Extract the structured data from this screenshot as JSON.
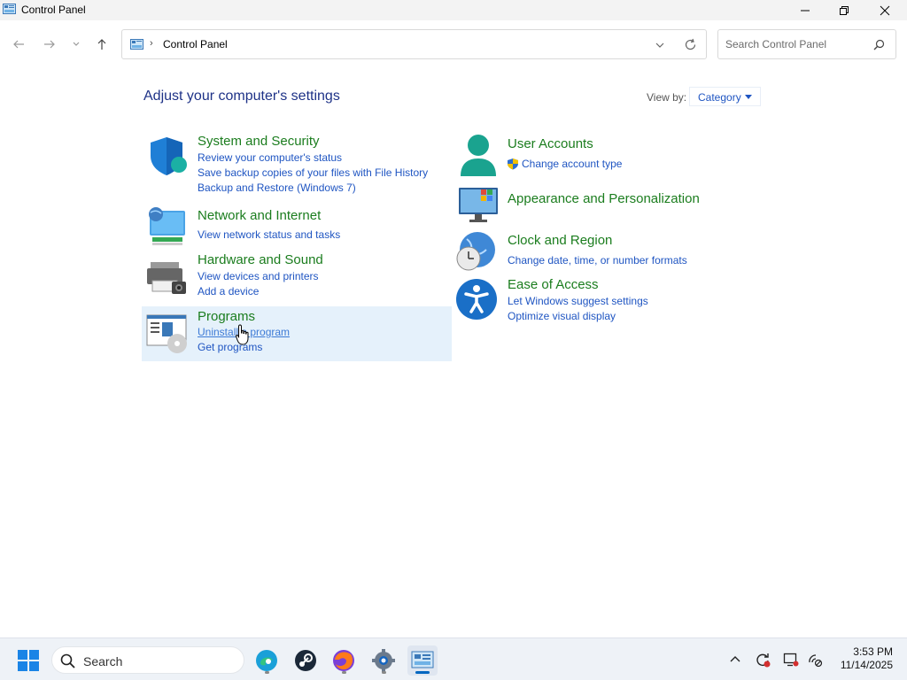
{
  "window": {
    "title": "Control Panel"
  },
  "address": {
    "crumb": "Control Panel",
    "search_placeholder": "Search Control Panel"
  },
  "content": {
    "heading": "Adjust your computer's settings",
    "view_by_label": "View by:",
    "view_by_value": "Category"
  },
  "categories": [
    {
      "title": "System and Security",
      "icon": "shield-icon",
      "links": [
        "Review your computer's status",
        "Save backup copies of your files with File History",
        "Backup and Restore (Windows 7)"
      ]
    },
    {
      "title": "Network and Internet",
      "icon": "network-icon",
      "links": [
        "View network status and tasks"
      ]
    },
    {
      "title": "Hardware and Sound",
      "icon": "printer-icon",
      "links": [
        "View devices and printers",
        "Add a device"
      ]
    },
    {
      "title": "Programs",
      "icon": "programs-icon",
      "links": [
        "Uninstall a program",
        "Get programs"
      ]
    },
    {
      "title": "User Accounts",
      "icon": "user-icon",
      "links": [
        "Change account type"
      ]
    },
    {
      "title": "Appearance and Personalization",
      "icon": "monitor-icon",
      "links": []
    },
    {
      "title": "Clock and Region",
      "icon": "clock-globe-icon",
      "links": [
        "Change date, time, or number formats"
      ]
    },
    {
      "title": "Ease of Access",
      "icon": "accessibility-icon",
      "links": [
        "Let Windows suggest settings",
        "Optimize visual display"
      ]
    }
  ],
  "taskbar": {
    "search_label": "Search",
    "time": "3:53 PM",
    "date": "11/14/2025",
    "apps": [
      "edge-icon",
      "steam-icon",
      "firefox-icon",
      "settings-icon",
      "control-panel-icon"
    ]
  }
}
